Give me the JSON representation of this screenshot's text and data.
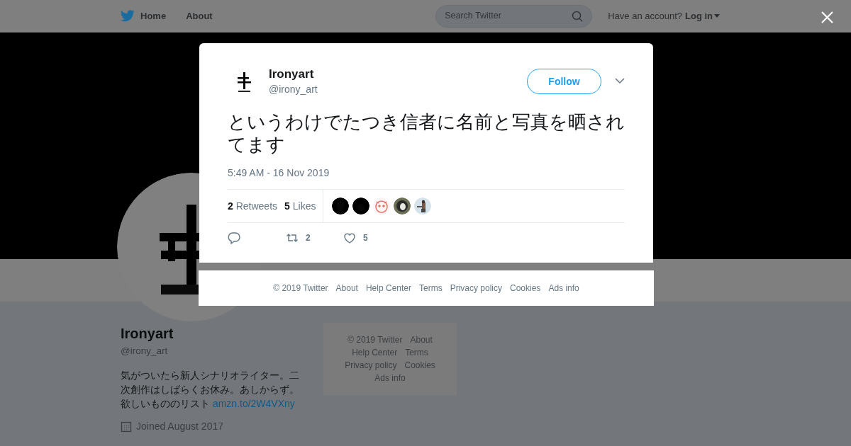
{
  "nav": {
    "items": [
      {
        "label": "Home",
        "kind": "home"
      },
      {
        "label": "About",
        "kind": "plain"
      }
    ],
    "search": {
      "placeholder": "Search Twitter"
    },
    "account_prompt": "Have an account?",
    "login": "Log in"
  },
  "profile": {
    "name": "Ironyart",
    "handle": "@irony_art",
    "bio": "気がついたら新人シナリオライター。二次創作はしばらくお休み。あしからず。欲しいもののリスト",
    "bio_link": "amzn.to/2W4VXny",
    "joined": "Joined August 2017"
  },
  "sidebar_footer": [
    "© 2019 Twitter",
    "About",
    "Help Center",
    "Terms",
    "Privacy policy",
    "Cookies",
    "Ads info"
  ],
  "tweet": {
    "name": "Ironyart",
    "handle": "@irony_art",
    "follow_button": "Follow",
    "text": "というわけでたつき信者に名前と写真を晒されてます",
    "time": "5:49 AM - 16 Nov 2019",
    "stats": [
      {
        "count": "2",
        "label": "Retweets"
      },
      {
        "count": "5",
        "label": "Likes"
      }
    ],
    "actions": [
      {
        "kind": "reply"
      },
      {
        "kind": "retweet",
        "count": "2"
      },
      {
        "kind": "like",
        "count": "5"
      }
    ]
  },
  "modal_footer": [
    "© 2019 Twitter",
    "About",
    "Help Center",
    "Terms",
    "Privacy policy",
    "Cookies",
    "Ads info"
  ]
}
